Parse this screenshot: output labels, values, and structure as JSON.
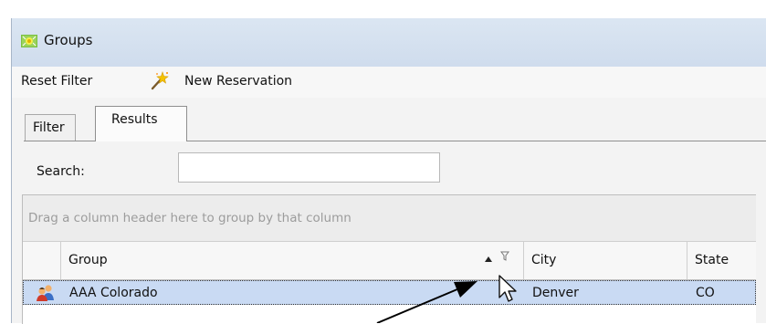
{
  "window": {
    "title": "Groups",
    "icon": "groups-icon"
  },
  "toolbar": {
    "reset_filter_label": "Reset Filter",
    "new_reservation_label": "New Reservation",
    "new_reservation_icon": "magic-wand-icon"
  },
  "tabs": [
    {
      "label": "Filter",
      "active": false
    },
    {
      "label": "Results",
      "active": true
    }
  ],
  "search": {
    "label": "Search:",
    "value": "",
    "placeholder": ""
  },
  "grid": {
    "group_panel_hint": "Drag a column header here to group by that column",
    "columns": [
      {
        "label": "Group",
        "sort": "ascending",
        "filterable": true
      },
      {
        "label": "City"
      },
      {
        "label": "State"
      }
    ],
    "rows": [
      {
        "icon": "group-people-icon",
        "group": "AAA Colorado",
        "city": "Denver",
        "state": "CO",
        "selected": true
      }
    ]
  },
  "colors": {
    "selected_row": "#c9daf3",
    "title_bar": "#d5e1ef",
    "hint_text": "#9c9c9c"
  }
}
